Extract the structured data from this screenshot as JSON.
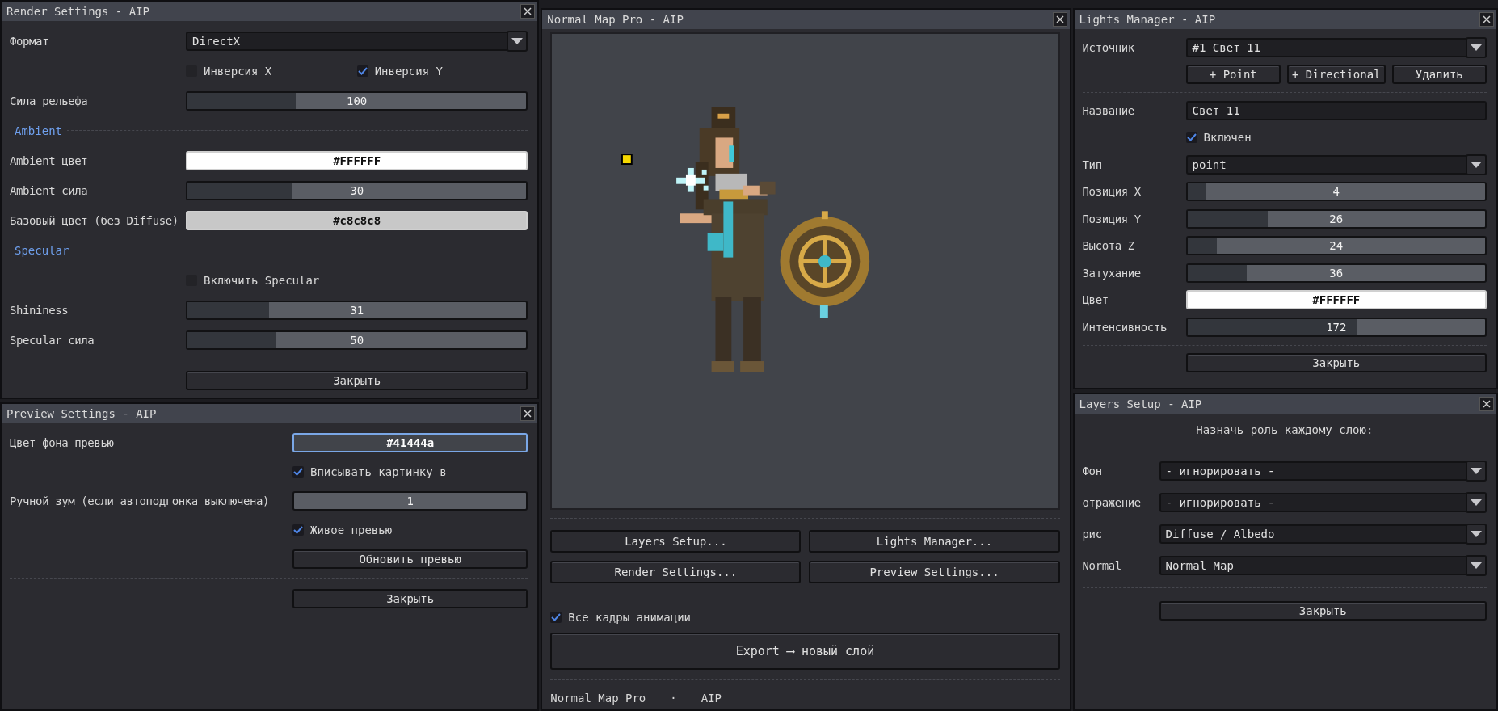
{
  "windows": [
    {
      "title": "Render Settings - AIP",
      "rows": [
        {
          "kind": "select",
          "label": "Формат",
          "value": "DirectX"
        },
        {
          "kind": "checks",
          "items": [
            {
              "label": "Инверсия X",
              "checked": false
            },
            {
              "label": "Инверсия Y",
              "checked": true
            }
          ]
        },
        {
          "kind": "slider",
          "label": "Сила рельефа",
          "value": "100",
          "level": 0.32
        },
        {
          "kind": "section",
          "label": "Ambient"
        },
        {
          "kind": "color",
          "label": "Ambient цвет",
          "value": "#FFFFFF",
          "color": "#ffffff",
          "focused": false
        },
        {
          "kind": "slider",
          "label": "Ambient сила",
          "value": "30",
          "level": 0.31
        },
        {
          "kind": "color",
          "label": "Базовый цвет (без Diffuse)",
          "value": "#c8c8c8",
          "color": "#c8c8c8",
          "focused": false
        },
        {
          "kind": "section",
          "label": "Specular"
        },
        {
          "kind": "checks",
          "items": [
            {
              "label": "Включить Specular",
              "checked": false
            }
          ]
        },
        {
          "kind": "slider",
          "label": "Shininess",
          "value": "31",
          "level": 0.24
        },
        {
          "kind": "slider",
          "label": "Specular сила",
          "value": "50",
          "level": 0.26
        },
        {
          "kind": "separator"
        },
        {
          "kind": "button",
          "label": "Закрыть"
        }
      ]
    },
    {
      "title": "Preview Settings - AIP",
      "rows": [
        {
          "kind": "color",
          "label": "Цвет фона превью",
          "value": "#41444a",
          "color": "#41444a",
          "focused": true
        },
        {
          "kind": "checks",
          "items": [
            {
              "label": "Вписывать картинку в",
              "checked": true
            }
          ]
        },
        {
          "kind": "slider",
          "label": "Ручной зум (если автоподгонка выключена)",
          "value": "1",
          "level": 0
        },
        {
          "kind": "checks",
          "items": [
            {
              "label": "Живое превью",
              "checked": true
            }
          ]
        },
        {
          "kind": "button",
          "label": "Обновить превью"
        },
        {
          "kind": "separator"
        },
        {
          "kind": "button",
          "label": "Закрыть"
        }
      ]
    },
    {
      "title": "Normal Map Pro - AIP",
      "rows": [
        {
          "kind": "canvas"
        },
        {
          "kind": "separator"
        },
        {
          "kind": "button_grid",
          "items": [
            "Layers Setup...",
            "Lights Manager...",
            "Render Settings...",
            "Preview Settings..."
          ]
        },
        {
          "kind": "separator"
        },
        {
          "kind": "checks",
          "items": [
            {
              "label": "Все кадры анимации",
              "checked": true
            }
          ]
        },
        {
          "kind": "big_button",
          "label": "Export ⟶ новый слой"
        },
        {
          "kind": "separator"
        },
        {
          "kind": "footer",
          "items": [
            "Normal Map Pro",
            "·",
            "AIP"
          ]
        }
      ]
    },
    {
      "title": "Lights Manager - AIP",
      "rows": [
        {
          "kind": "select",
          "label": "Источник",
          "value": "#1 Свет 11"
        },
        {
          "kind": "buttons",
          "items": [
            "+ Point",
            "+ Directional",
            "Удалить"
          ]
        },
        {
          "kind": "separator"
        },
        {
          "kind": "field",
          "label": "Название",
          "value": "Свет 11"
        },
        {
          "kind": "checks",
          "items": [
            {
              "label": "Включен",
              "checked": true
            }
          ]
        },
        {
          "kind": "select",
          "label": "Тип",
          "value": "point"
        },
        {
          "kind": "slider",
          "label": "Позиция X",
          "value": "4",
          "level": 0.06
        },
        {
          "kind": "slider",
          "label": "Позиция Y",
          "value": "26",
          "level": 0.27
        },
        {
          "kind": "slider",
          "label": "Высота Z",
          "value": "24",
          "level": 0.1
        },
        {
          "kind": "slider",
          "label": "Затухание",
          "value": "36",
          "level": 0.2
        },
        {
          "kind": "color",
          "label": "Цвет",
          "value": "#FFFFFF",
          "color": "#ffffff",
          "focused": false
        },
        {
          "kind": "slider",
          "label": "Интенсивность",
          "value": "172",
          "level": 0.57
        },
        {
          "kind": "separator"
        },
        {
          "kind": "button",
          "label": "Закрыть"
        }
      ]
    },
    {
      "title": "Layers Setup - AIP",
      "rows": [
        {
          "kind": "heading",
          "label": "Назначь роль каждому слою:"
        },
        {
          "kind": "separator"
        },
        {
          "kind": "select",
          "label": "Фон",
          "value": "- игнорировать -"
        },
        {
          "kind": "select",
          "label": "отражение",
          "value": "- игнорировать -"
        },
        {
          "kind": "select",
          "label": "рис",
          "value": "Diffuse / Albedo"
        },
        {
          "kind": "select",
          "label": "Normal",
          "value": "Normal Map"
        },
        {
          "kind": "separator"
        },
        {
          "kind": "button",
          "label": "Закрыть"
        }
      ]
    }
  ]
}
